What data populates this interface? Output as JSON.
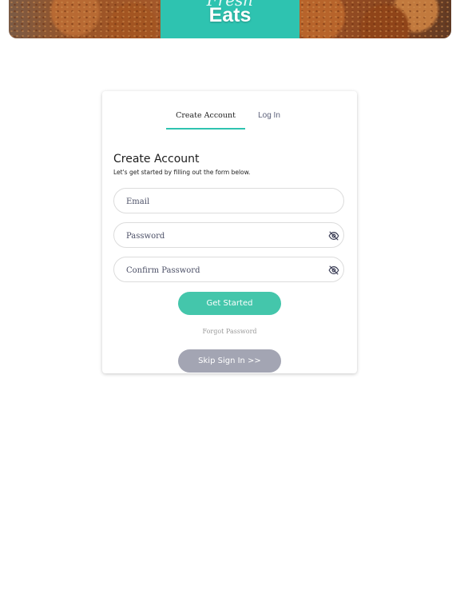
{
  "hero": {
    "script_text": "Fresh",
    "title": "Eats"
  },
  "tabs": [
    {
      "label": "Create Account",
      "active": true
    },
    {
      "label": "Log In",
      "active": false
    }
  ],
  "form": {
    "title": "Create Account",
    "subtitle": "Let's get started by filling out the form below.",
    "email_placeholder": "Email",
    "password_placeholder": "Password",
    "confirm_placeholder": "Confirm Password",
    "submit_label": "Get Started",
    "forgot_label": "Forgot Password",
    "skip_label": "Skip Sign In >>"
  },
  "icons": {
    "password_toggle": "eye-off-icon",
    "confirm_toggle": "eye-off-icon"
  },
  "colors": {
    "accent": "#2ec3b0",
    "primary_button": "#44c6ab",
    "skip_button": "#a3a5b3"
  }
}
